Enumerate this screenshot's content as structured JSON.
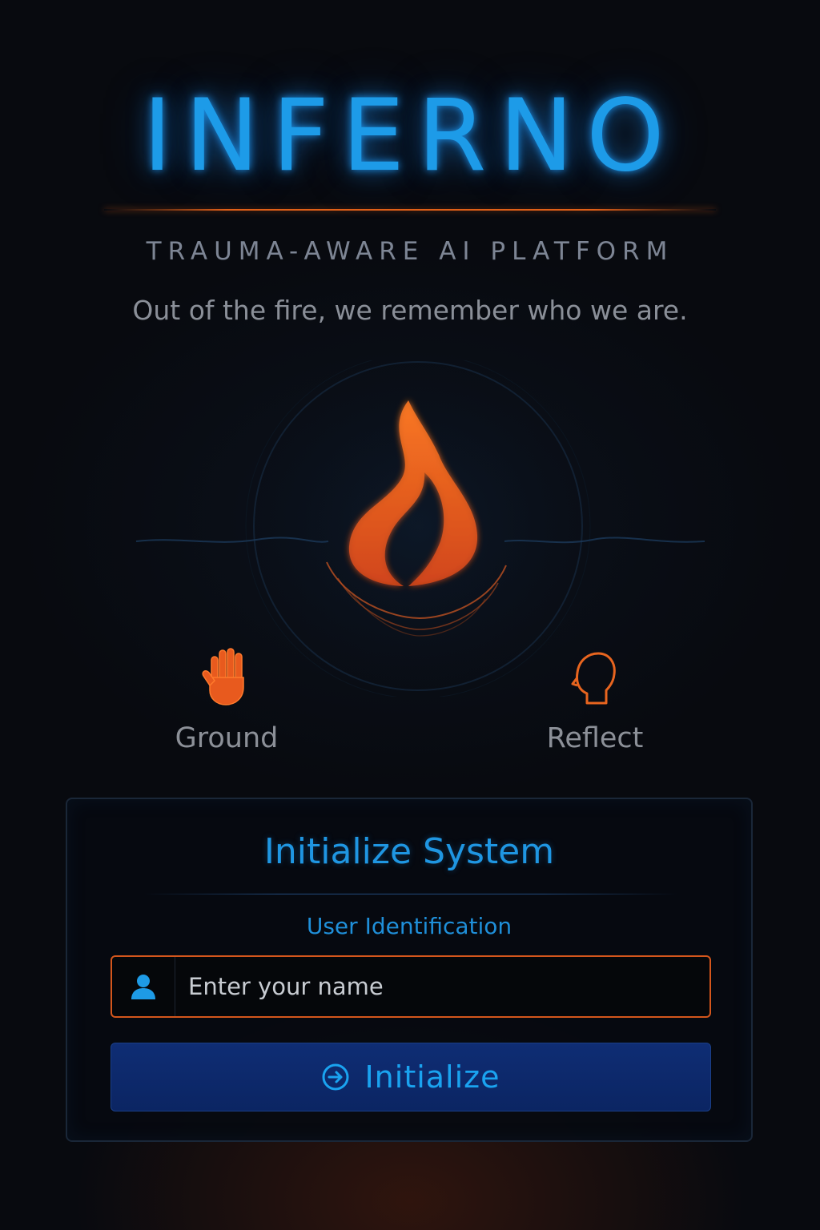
{
  "header": {
    "title": "INFERNO",
    "subtitle": "TRAUMA-AWARE AI PLATFORM",
    "tagline": "Out of the fire, we remember who we are."
  },
  "choices": [
    {
      "label": "Ground",
      "icon": "hand-icon"
    },
    {
      "label": "Reflect",
      "icon": "head-profile-icon"
    }
  ],
  "card": {
    "title": "Initialize System",
    "field_label": "User Identification",
    "name_input": {
      "placeholder": "Enter your name",
      "value": "",
      "icon": "user-icon"
    },
    "submit_label": "Initialize",
    "submit_icon": "arrow-circle-icon"
  },
  "colors": {
    "accent_blue": "#1f96e2",
    "accent_orange": "#e8651f",
    "background": "#080a0f",
    "button_bg": "#0f2d74"
  }
}
